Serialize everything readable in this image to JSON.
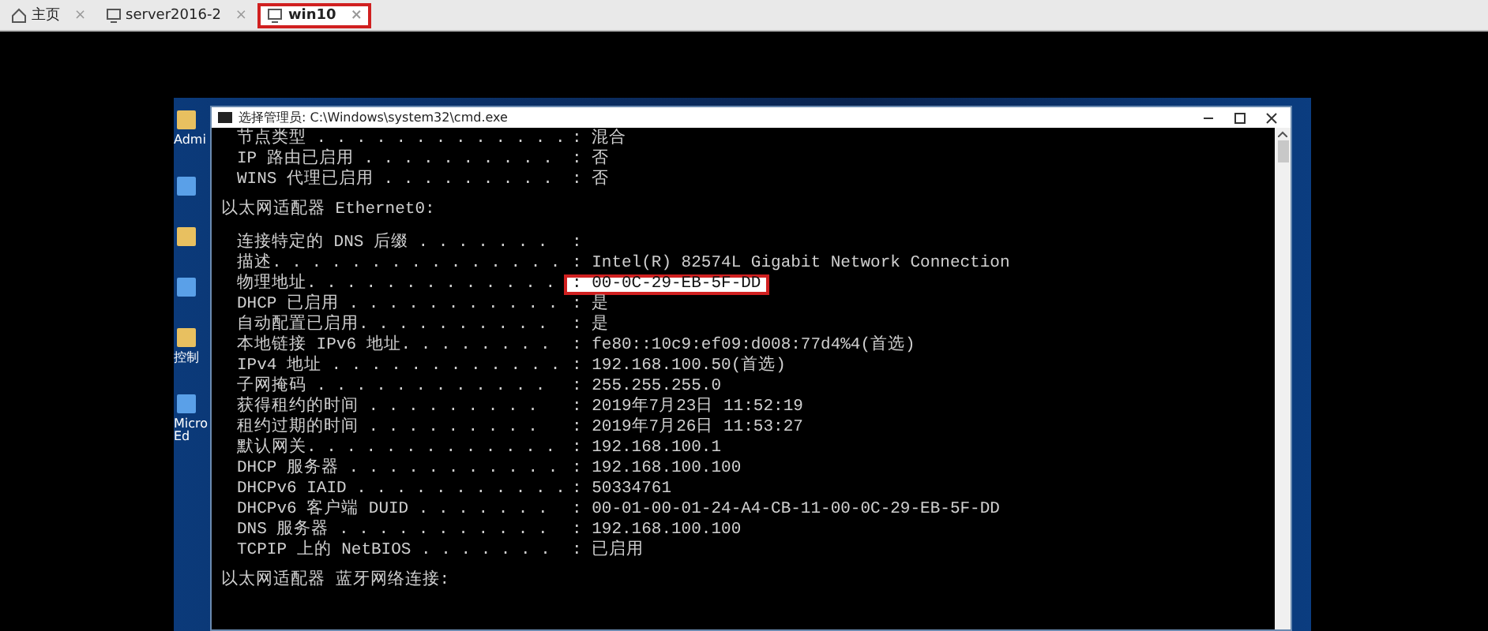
{
  "tabs": [
    {
      "label": "主页",
      "kind": "home",
      "close": "×",
      "selected": false
    },
    {
      "label": "server2016-2",
      "kind": "vm",
      "close": "×",
      "selected": false
    },
    {
      "label": "win10",
      "kind": "vm",
      "close": "×",
      "selected": true
    }
  ],
  "desktop": {
    "icons": [
      {
        "kind": "folder",
        "label": "Admi"
      },
      {
        "kind": "app"
      },
      {
        "kind": "folder"
      },
      {
        "kind": "app"
      },
      {
        "kind": "folder",
        "label": "控制"
      },
      {
        "kind": "app",
        "label": "Micro Ed"
      }
    ]
  },
  "cmd_window": {
    "title": "选择管理员: C:\\Windows\\system32\\cmd.exe",
    "lines": [
      {
        "kind": "entry",
        "label": "节点类型 . . . . . . . . . . . . .",
        "value": ": 混合",
        "highlighted": false
      },
      {
        "kind": "entry",
        "label": "IP 路由已启用 . . . . . . . . . .",
        "value": ": 否",
        "highlighted": false
      },
      {
        "kind": "entry",
        "label": "WINS 代理已启用 . . . . . . . . .",
        "value": ": 否",
        "highlighted": false
      },
      {
        "kind": "heading",
        "label": "以太网适配器 Ethernet0:"
      },
      {
        "kind": "entry",
        "label": "连接特定的 DNS 后缀 . . . . . . .",
        "value": ":",
        "highlighted": false
      },
      {
        "kind": "entry",
        "label": "描述. . . . . . . . . . . . . . .",
        "value": ": Intel(R) 82574L Gigabit Network Connection",
        "highlighted": false
      },
      {
        "kind": "entry",
        "label": "物理地址. . . . . . . . . . . . .",
        "value": ": 00-0C-29-EB-5F-DD",
        "highlighted": true
      },
      {
        "kind": "entry",
        "label": "DHCP 已启用 . . . . . . . . . . .",
        "value": ": 是",
        "highlighted": false
      },
      {
        "kind": "entry",
        "label": "自动配置已启用. . . . . . . . . .",
        "value": ": 是",
        "highlighted": false
      },
      {
        "kind": "entry",
        "label": "本地链接 IPv6 地址. . . . . . . .",
        "value": ": fe80::10c9:ef09:d008:77d4%4(首选)",
        "highlighted": false
      },
      {
        "kind": "entry",
        "label": "IPv4 地址 . . . . . . . . . . . .",
        "value": ": 192.168.100.50(首选)",
        "highlighted": false
      },
      {
        "kind": "entry",
        "label": "子网掩码 . . . . . . . . . . . .",
        "value": ": 255.255.255.0",
        "highlighted": false
      },
      {
        "kind": "entry",
        "label": "获得租约的时间 . . . . . . . . .",
        "value": ": 2019年7月23日 11:52:19",
        "highlighted": false
      },
      {
        "kind": "entry",
        "label": "租约过期的时间 . . . . . . . . .",
        "value": ": 2019年7月26日 11:53:27",
        "highlighted": false
      },
      {
        "kind": "entry",
        "label": "默认网关. . . . . . . . . . . . .",
        "value": ": 192.168.100.1",
        "highlighted": false
      },
      {
        "kind": "entry",
        "label": "DHCP 服务器 . . . . . . . . . . .",
        "value": ": 192.168.100.100",
        "highlighted": false
      },
      {
        "kind": "entry",
        "label": "DHCPv6 IAID . . . . . . . . . . .",
        "value": ": 50334761",
        "highlighted": false
      },
      {
        "kind": "entry",
        "label": "DHCPv6 客户端 DUID . . . . . . .",
        "value": ": 00-01-00-01-24-A4-CB-11-00-0C-29-EB-5F-DD",
        "highlighted": false
      },
      {
        "kind": "entry",
        "label": "DNS 服务器 . . . . . . . . . . .",
        "value": ": 192.168.100.100",
        "highlighted": false
      },
      {
        "kind": "entry",
        "label": "TCPIP 上的 NetBIOS . . . . . . .",
        "value": ": 已启用",
        "highlighted": false
      },
      {
        "kind": "heading",
        "label": "以太网适配器 蓝牙网络连接:"
      }
    ]
  }
}
